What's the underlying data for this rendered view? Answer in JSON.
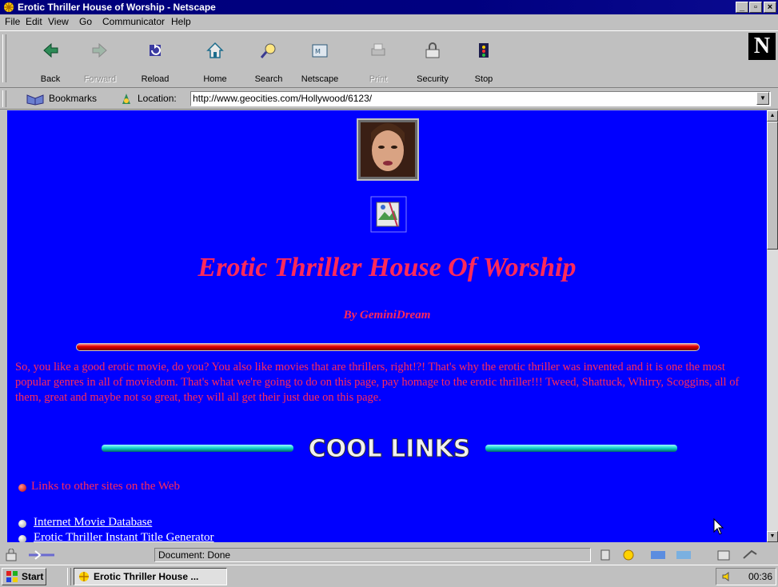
{
  "window": {
    "title": "Erotic Thriller House of Worship - Netscape",
    "minimize": "_",
    "maximize": "▫",
    "close": "×"
  },
  "menu": [
    "File",
    "Edit",
    "View",
    "Go",
    "Communicator",
    "Help"
  ],
  "toolbar": {
    "buttons": [
      {
        "label": "Back",
        "icon": "back-arrow-icon",
        "enabled": true
      },
      {
        "label": "Forward",
        "icon": "forward-arrow-icon",
        "enabled": false
      },
      {
        "label": "Reload",
        "icon": "reload-icon",
        "enabled": true
      },
      {
        "label": "Home",
        "icon": "home-icon",
        "enabled": true
      },
      {
        "label": "Search",
        "icon": "search-icon",
        "enabled": true
      },
      {
        "label": "Netscape",
        "icon": "netscape-icon",
        "enabled": true
      },
      {
        "label": "Print",
        "icon": "print-icon",
        "enabled": false
      },
      {
        "label": "Security",
        "icon": "security-lock-icon",
        "enabled": true
      },
      {
        "label": "Stop",
        "icon": "stop-icon",
        "enabled": true
      }
    ],
    "logo": "N"
  },
  "location_bar": {
    "bookmarks_label": "Bookmarks",
    "location_label": "Location:",
    "url": "http://www.geocities.com/Hollywood/6123/"
  },
  "page": {
    "title": "Erotic Thriller House Of Worship",
    "byline": "By GeminiDream",
    "intro": "So, you like a good erotic movie, do you? You also like movies that are thrillers, right!?! That's why the erotic thriller was invented and it is one the most popular genres in all of moviedom. That's what we're going to do on this page, pay homage to the erotic thriller!!! Tweed, Shattuck, Whirry, Scoggins, all of them, great and maybe not so great, they will all get their just due on this page.",
    "cool_links_banner": "COOL LINKS",
    "links_heading": "Links to other sites on the Web",
    "links": [
      "Internet Movie Database",
      "Erotic Thriller Instant Title Generator"
    ]
  },
  "status_bar": {
    "text": "Document: Done"
  },
  "taskbar": {
    "start": "Start",
    "task": "Erotic Thriller House ...",
    "clock": "00:36"
  },
  "colors": {
    "page_background": "#0000ff",
    "heading_red": "#ff2a5a",
    "title_bar": "#000080",
    "chrome_gray": "#c0c0c0"
  }
}
